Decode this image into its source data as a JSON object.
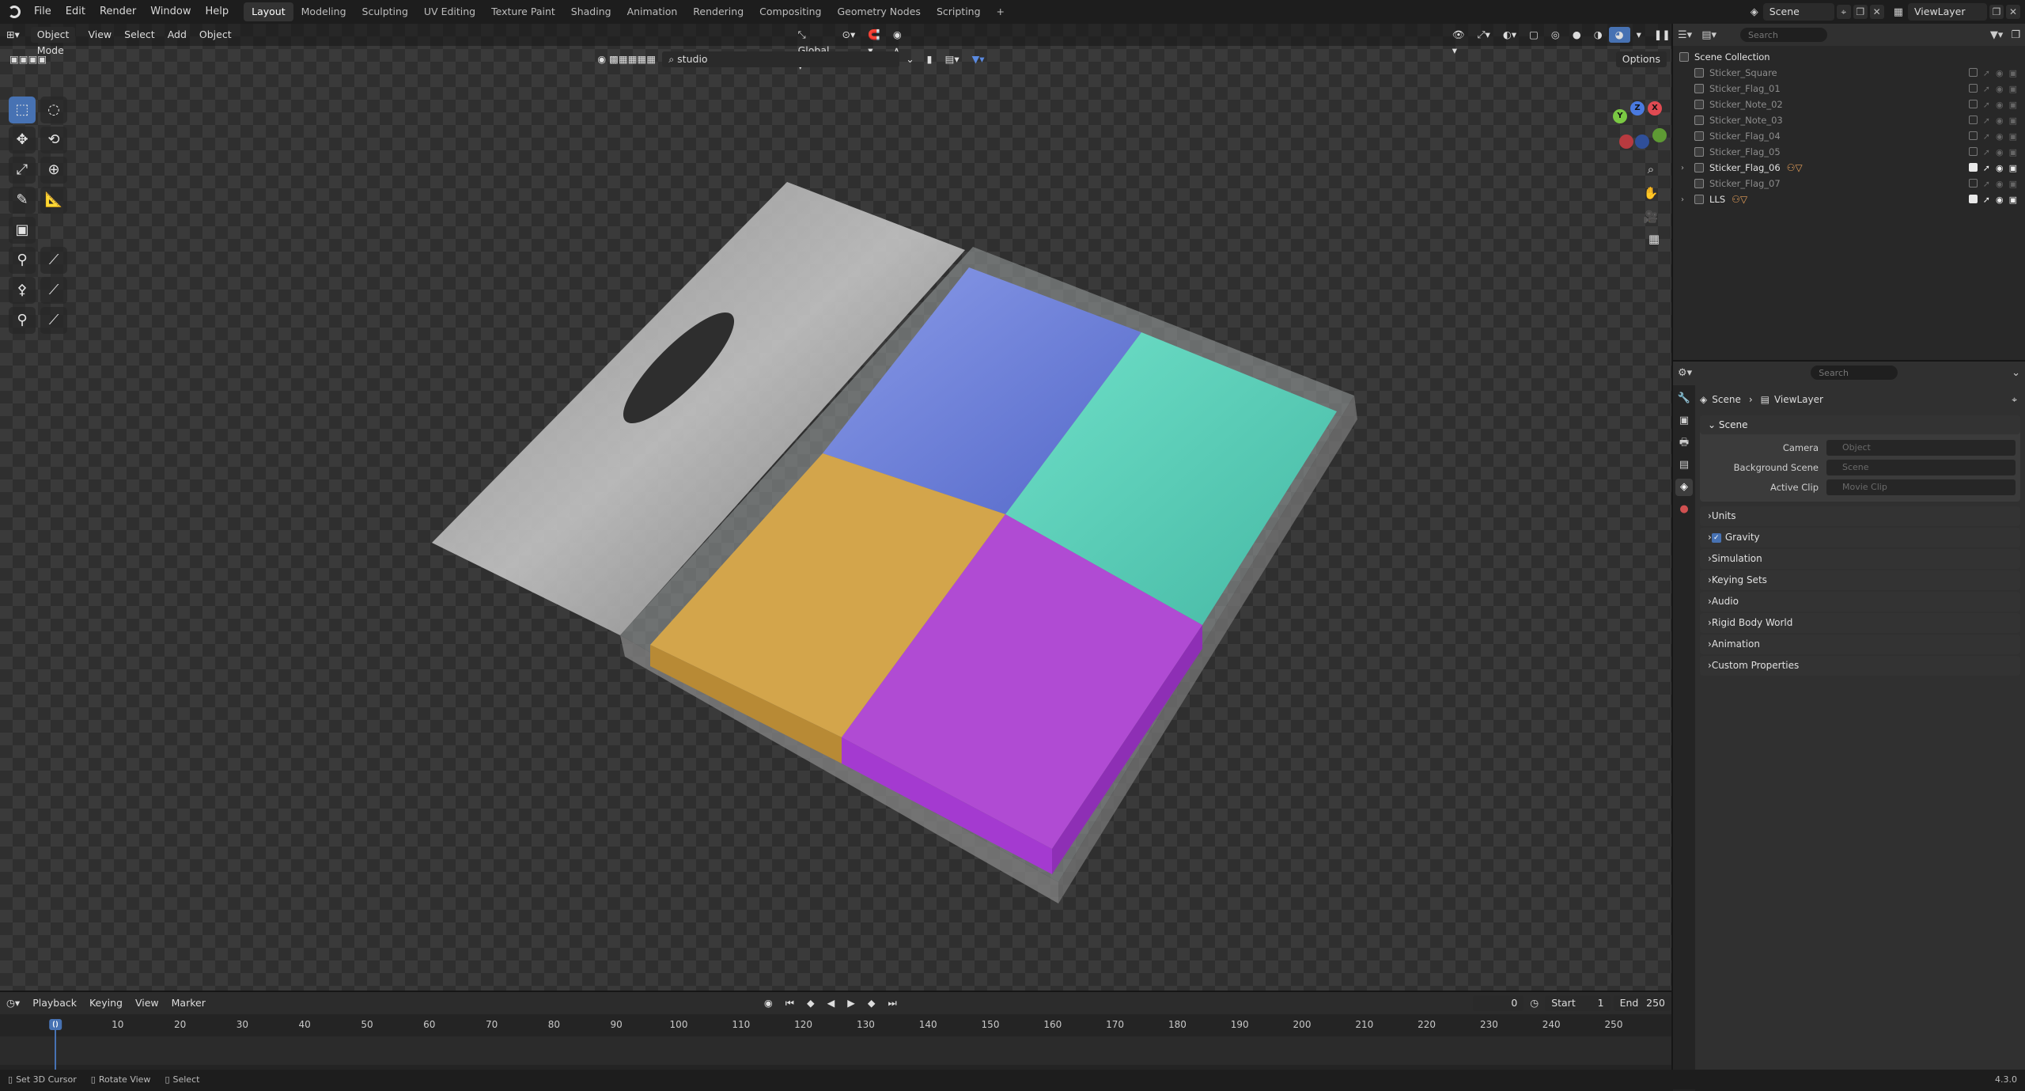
{
  "menu": [
    "File",
    "Edit",
    "Render",
    "Window",
    "Help"
  ],
  "workspaces": [
    "Layout",
    "Modeling",
    "Sculpting",
    "UV Editing",
    "Texture Paint",
    "Shading",
    "Animation",
    "Rendering",
    "Compositing",
    "Geometry Nodes",
    "Scripting",
    "+"
  ],
  "scene": {
    "name": "Scene",
    "view_layer": "ViewLayer"
  },
  "viewport": {
    "mode": "Object Mode",
    "menus": [
      "View",
      "Select",
      "Add",
      "Object"
    ],
    "orientation": "Global",
    "search_value": "studio",
    "options": "Options"
  },
  "gizmo": {
    "x": "X",
    "y": "Y",
    "z": "Z"
  },
  "outliner": {
    "search_placeholder": "Search",
    "collection": "Scene Collection",
    "items": [
      {
        "name": "Sticker_Square",
        "visible": false
      },
      {
        "name": "Sticker_Flag_01",
        "visible": false
      },
      {
        "name": "Sticker_Note_02",
        "visible": false
      },
      {
        "name": "Sticker_Note_03",
        "visible": false
      },
      {
        "name": "Sticker_Flag_04",
        "visible": false
      },
      {
        "name": "Sticker_Flag_05",
        "visible": false
      },
      {
        "name": "Sticker_Flag_06",
        "visible": true
      },
      {
        "name": "Sticker_Flag_07",
        "visible": false
      },
      {
        "name": "LLS",
        "visible": true
      }
    ]
  },
  "properties": {
    "search_placeholder": "Search",
    "breadcrumb": [
      "Scene",
      "ViewLayer"
    ],
    "panel_title": "Scene",
    "fields": [
      {
        "label": "Camera",
        "placeholder": "Object"
      },
      {
        "label": "Background Scene",
        "placeholder": "Scene"
      },
      {
        "label": "Active Clip",
        "placeholder": "Movie Clip"
      }
    ],
    "subpanels": [
      "Units",
      "Gravity",
      "Simulation",
      "Keying Sets",
      "Audio",
      "Rigid Body World",
      "Animation",
      "Custom Properties"
    ]
  },
  "timeline": {
    "menus": [
      "Playback",
      "Keying",
      "View",
      "Marker"
    ],
    "current_frame": "0",
    "start_label": "Start",
    "start": "1",
    "end_label": "End",
    "end": "250",
    "ticks": [
      "0",
      "10",
      "20",
      "30",
      "40",
      "50",
      "60",
      "70",
      "80",
      "90",
      "100",
      "110",
      "120",
      "130",
      "140",
      "150",
      "160",
      "170",
      "180",
      "190",
      "200",
      "210",
      "220",
      "230",
      "240",
      "250"
    ]
  },
  "status": {
    "items": [
      "Set 3D Cursor",
      "Rotate View",
      "Select"
    ],
    "version": "4.3.0"
  },
  "colors": {
    "accent": "#4772b3",
    "blue_note": "#6f85e0",
    "teal_note": "#5fd3bc",
    "yellow_note": "#d8a94e",
    "purple_note": "#b04fd3"
  }
}
